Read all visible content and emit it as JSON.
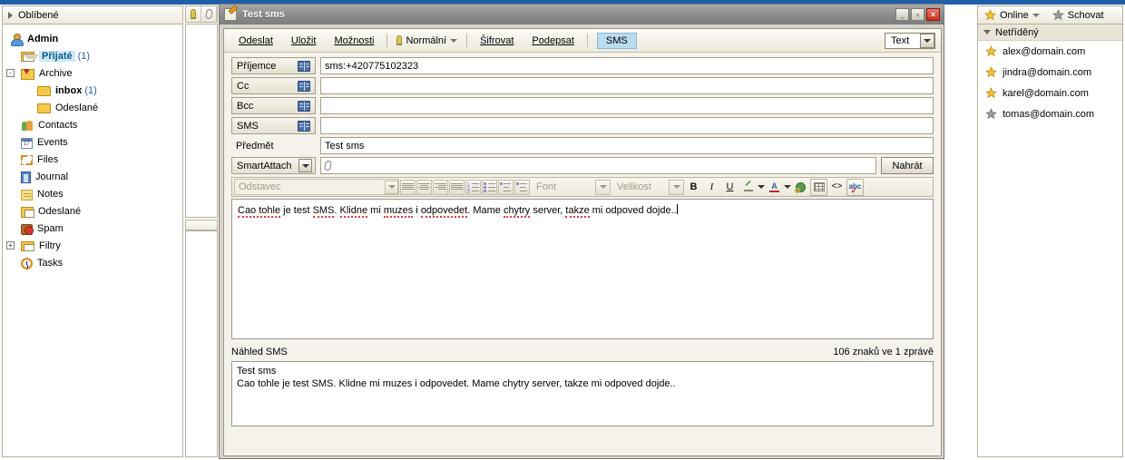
{
  "left_panel": {
    "header": {
      "label": "Oblíbené",
      "icon": "triangle-right-icon"
    },
    "account": {
      "label": "Admin",
      "icon": "user-icon"
    },
    "tree": [
      {
        "label": "Přijaté",
        "count": "(1)",
        "icon": "inbox-folder-icon",
        "selected": true,
        "indent": 1
      },
      {
        "label": "Archive",
        "count": "",
        "icon": "archive-heart-icon",
        "selected": false,
        "indent": 1,
        "expander": "-"
      },
      {
        "label": "inbox",
        "count": "(1)",
        "icon": "folder-icon",
        "selected": false,
        "indent": 2,
        "bold": true
      },
      {
        "label": "Odeslané",
        "count": "",
        "icon": "folder-icon",
        "selected": false,
        "indent": 2
      },
      {
        "label": "Contacts",
        "count": "",
        "icon": "contacts-icon",
        "selected": false,
        "indent": 1
      },
      {
        "label": "Events",
        "count": "",
        "icon": "calendar-icon",
        "selected": false,
        "indent": 1
      },
      {
        "label": "Files",
        "count": "",
        "icon": "files-icon",
        "selected": false,
        "indent": 1
      },
      {
        "label": "Journal",
        "count": "",
        "icon": "journal-icon",
        "selected": false,
        "indent": 1
      },
      {
        "label": "Notes",
        "count": "",
        "icon": "notes-icon",
        "selected": false,
        "indent": 1
      },
      {
        "label": "Odeslané",
        "count": "",
        "icon": "sent-mail-icon",
        "selected": false,
        "indent": 1
      },
      {
        "label": "Spam",
        "count": "",
        "icon": "spam-icon",
        "selected": false,
        "indent": 1
      },
      {
        "label": "Filtry",
        "count": "",
        "icon": "filter-icon",
        "selected": false,
        "indent": 1,
        "expander": "+"
      },
      {
        "label": "Tasks",
        "count": "",
        "icon": "tasks-clock-icon",
        "selected": false,
        "indent": 1
      }
    ]
  },
  "mid_strip": {
    "tools": [
      {
        "name": "priority-key-icon"
      },
      {
        "name": "attachment-clip-icon"
      }
    ]
  },
  "compose_window": {
    "title": "Test sms",
    "window_buttons": {
      "minimize": "_",
      "maximize": "▫",
      "close": "✕"
    },
    "toolbar": {
      "send": "Odeslat",
      "save": "Uložit",
      "options": "Možnosti",
      "priority": "Normální",
      "encrypt": "Šifrovat",
      "sign": "Podepsat",
      "sms_tab": "SMS",
      "format_select": "Text"
    },
    "fields": {
      "to_label": "Příjemce",
      "to_value": "sms:+420775102323",
      "cc_label": "Cc",
      "cc_value": "",
      "bcc_label": "Bcc",
      "bcc_value": "",
      "sms_label": "SMS",
      "sms_value": "",
      "subject_label": "Předmět",
      "subject_value": "Test sms",
      "attach_label": "SmartAttach",
      "attach_value": "",
      "upload_button": "Nahrát"
    },
    "format_toolbar": {
      "paragraph": "Odstavec",
      "font": "Font",
      "size": "Velikost",
      "bold": "B",
      "italic": "I",
      "underline": "U",
      "highlight_icon": "highlighter-icon",
      "text_color_icon": "text-color-icon",
      "link_icon": "insert-link-globe-icon",
      "table_icon": "insert-table-icon",
      "source_icon": "source-code-icon",
      "spellcheck_icon": "spellcheck-abc-icon",
      "align_left_icon": "align-left-icon",
      "align_center_icon": "align-center-icon",
      "align_right_icon": "align-right-icon",
      "align_justify_icon": "align-justify-icon",
      "numbered_list_icon": "numbered-list-icon",
      "bulleted_list_icon": "bulleted-list-icon",
      "outdent_icon": "outdent-icon",
      "indent_icon": "indent-icon"
    },
    "body": {
      "part1": "Cao tohle",
      "sp1": "Cao tohle",
      "text": "Cao tohle je test SMS. Klidne mi muzes i odpovedet. Mame chytry server, takze mi odpoved dojde..",
      "w_cao": "Cao tohle",
      "w_je": " je test ",
      "w_sms": "SMS",
      "w_dot1": ". ",
      "w_klidne": "Klidne",
      "w_mi": " mi ",
      "w_muzes": "muzes",
      "w_i": " i ",
      "w_odpovedet": "odpovedet",
      "w_mame": ". Mame ",
      "w_chytry": "chytry",
      "w_server": " server, ",
      "w_takze": "takze",
      "w_tail": " mi odpoved dojde.."
    },
    "preview": {
      "title": "Náhled SMS",
      "counter": "106 znaků ve 1 zprávě",
      "line1": "Test sms",
      "line2": "Cao tohle je test SMS. Klidne mi muzes i odpovedet. Mame chytry server, takze mi odpoved dojde.."
    }
  },
  "right_panel": {
    "online_button": "Online",
    "hide_button": "Schovat",
    "group_label": "Netříděný",
    "contacts": [
      {
        "name": "alex@domain.com",
        "status": "online"
      },
      {
        "name": "jindra@domain.com",
        "status": "online"
      },
      {
        "name": "karel@domain.com",
        "status": "online"
      },
      {
        "name": "tomas@domain.com",
        "status": "offline"
      }
    ]
  },
  "colors": {
    "accent_blue": "#1f5fa9",
    "selection_blue": "#cfe8f7",
    "tab_blue": "#b9dcf0",
    "star_online": "#f5c130",
    "star_offline": "#9d9d9d",
    "spell_error": "#e23b3b"
  }
}
